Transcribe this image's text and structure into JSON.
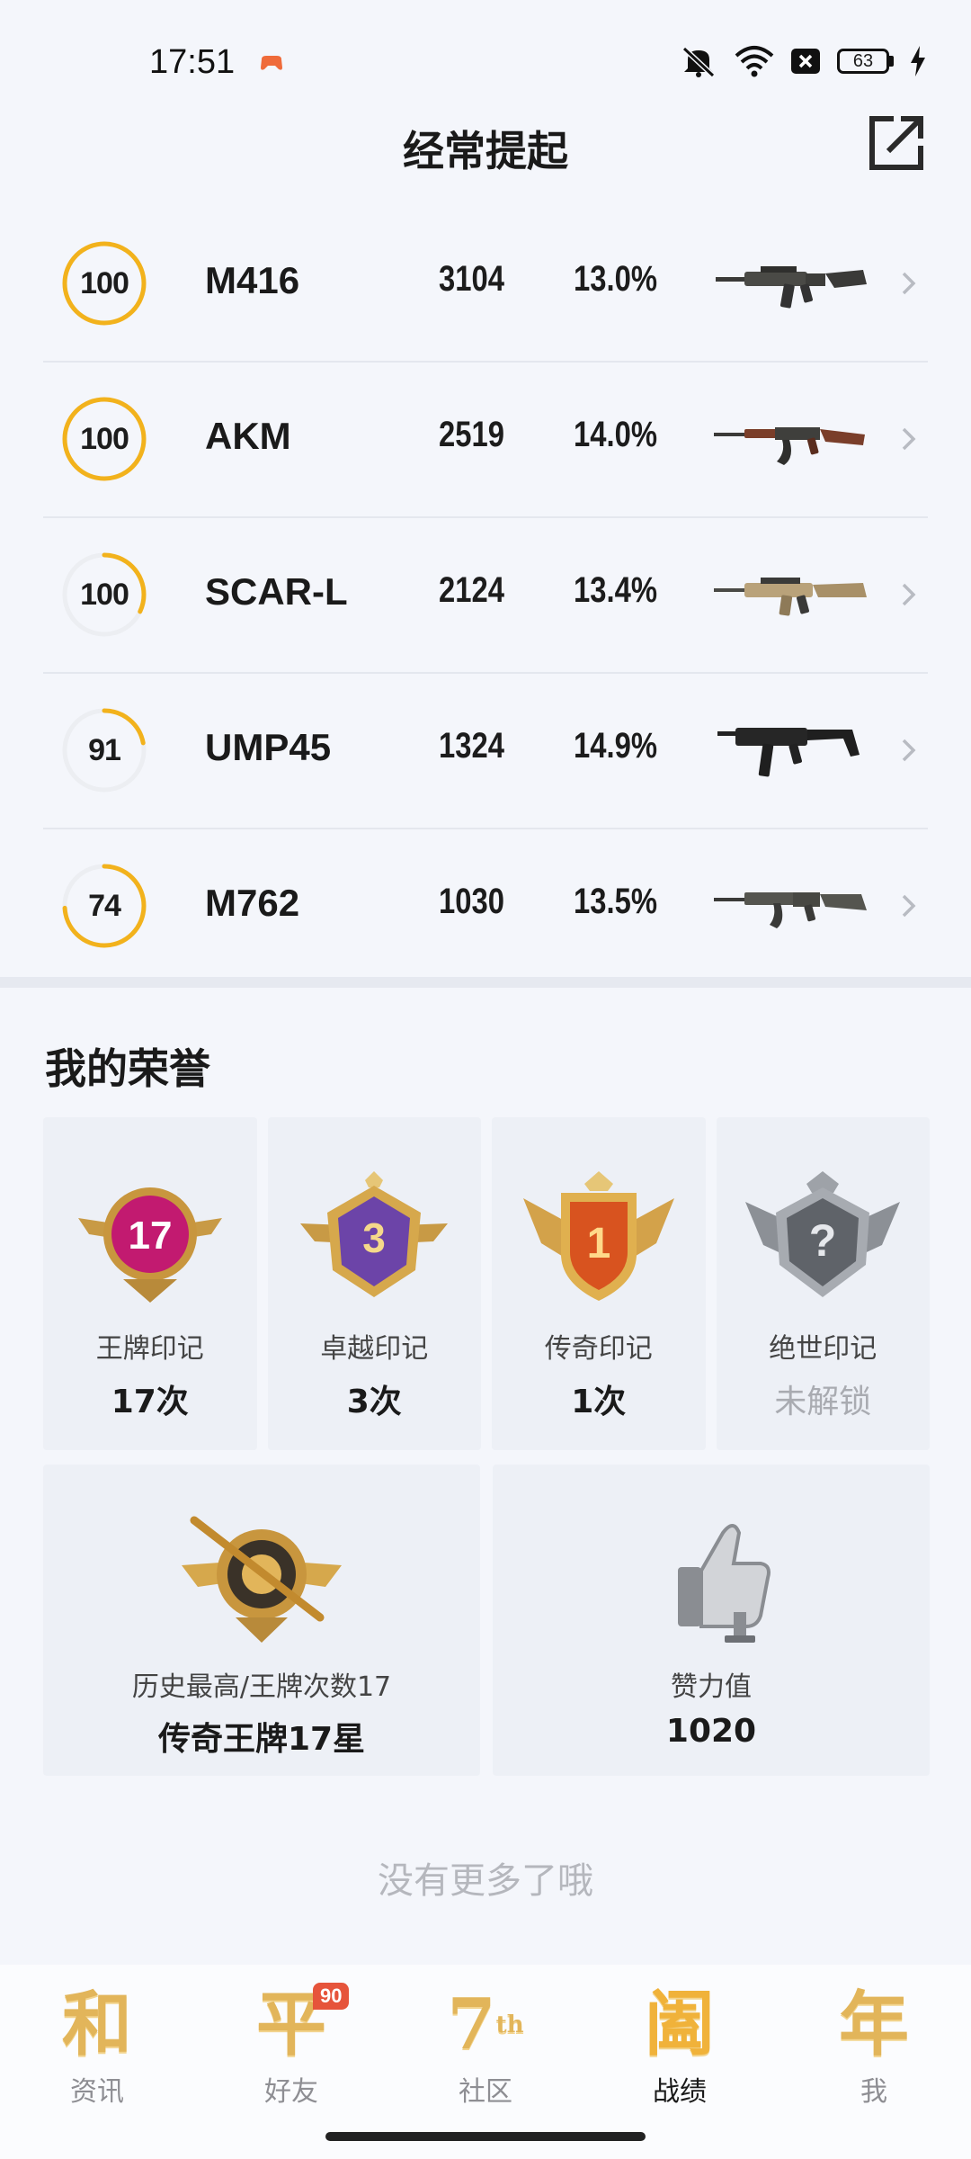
{
  "status_bar": {
    "time": "17:51",
    "battery": "63",
    "icons": [
      "game-app-icon",
      "mute-icon",
      "wifi-icon",
      "close-box-icon",
      "battery-icon",
      "charging-icon"
    ]
  },
  "header": {
    "title": "经常提起",
    "share_icon": "share-external-icon"
  },
  "weapons": [
    {
      "score": "100",
      "score_fraction": 1.0,
      "name": "M416",
      "count": "3104",
      "rate": "13.0%",
      "ring_color": "#f2b21c"
    },
    {
      "score": "100",
      "score_fraction": 1.0,
      "name": "AKM",
      "count": "2519",
      "rate": "14.0%",
      "ring_color": "#f2b21c"
    },
    {
      "score": "100",
      "score_fraction": 0.32,
      "name": "SCAR-L",
      "count": "2124",
      "rate": "13.4%",
      "ring_color": "#f2b21c"
    },
    {
      "score": "91",
      "score_fraction": 0.22,
      "name": "UMP45",
      "count": "1324",
      "rate": "14.9%",
      "ring_color": "#f2b21c"
    },
    {
      "score": "74",
      "score_fraction": 0.74,
      "name": "M762",
      "count": "1030",
      "rate": "13.5%",
      "ring_color": "#f2b21c"
    }
  ],
  "honors": {
    "title": "我的荣誉",
    "cards": [
      {
        "label": "王牌印记",
        "value": "17次",
        "badge_text": "17",
        "badge_icon": "ace-badge-icon"
      },
      {
        "label": "卓越印记",
        "value": "3次",
        "badge_text": "3",
        "badge_icon": "excellence-badge-icon"
      },
      {
        "label": "传奇印记",
        "value": "1次",
        "badge_text": "1",
        "badge_icon": "legend-badge-icon"
      },
      {
        "label": "绝世印记",
        "value": "未解锁",
        "badge_text": "?",
        "badge_icon": "locked-badge-icon"
      }
    ],
    "summary": [
      {
        "label": "历史最高/王牌次数17",
        "value": "传奇王牌17星",
        "icon": "rank-emblem-icon"
      },
      {
        "label": "赞力值",
        "value": "1020",
        "icon": "thumbs-up-icon"
      }
    ]
  },
  "footer_text": "没有更多了哦",
  "bottom_nav": [
    {
      "glyph": "和",
      "label": "资讯",
      "active": false
    },
    {
      "glyph": "平",
      "label": "好友",
      "active": false,
      "badge": "90"
    },
    {
      "glyph": "7",
      "label": "社区",
      "active": false,
      "sub": "th"
    },
    {
      "glyph": "阖",
      "label": "战绩",
      "active": true
    },
    {
      "glyph": "年",
      "label": "我",
      "active": false
    }
  ],
  "colors": {
    "accent": "#f2b21c",
    "ring_track": "#eceef2",
    "nav_gold": "#e2b55a"
  }
}
